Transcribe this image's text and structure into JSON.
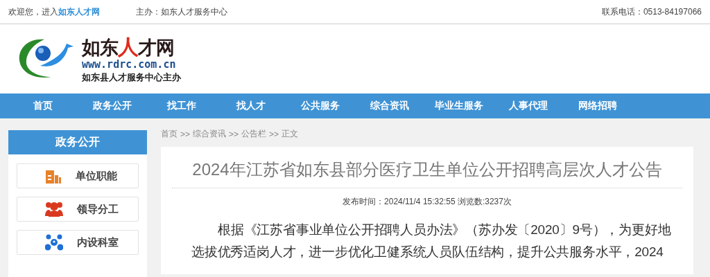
{
  "top_bar": {
    "welcome": "欢迎您，进入",
    "site_link": "如东人才网",
    "host": "主办：如东人才服务中心",
    "phone": "联系电话：0513-84197066"
  },
  "logo": {
    "title_parts": [
      {
        "text": "如东",
        "highlight": false
      },
      {
        "text": "人",
        "highlight": true
      },
      {
        "text": "才网",
        "highlight": false
      }
    ],
    "url": "www.rdrc.com.cn",
    "subtitle": "如东县人才服务中心主办"
  },
  "nav": [
    {
      "label": "首页"
    },
    {
      "label": "政务公开"
    },
    {
      "label": "找工作"
    },
    {
      "label": "找人才"
    },
    {
      "label": "公共服务"
    },
    {
      "label": "综合资讯"
    },
    {
      "label": "毕业生服务"
    },
    {
      "label": "人事代理"
    },
    {
      "label": "网络招聘"
    }
  ],
  "sidebar": {
    "title": "政务公开",
    "items": [
      {
        "label": "单位职能",
        "kind": "building",
        "color": "#e8822a"
      },
      {
        "label": "领导分工",
        "kind": "people",
        "color": "#d93a1f"
      },
      {
        "label": "内设科室",
        "kind": "network",
        "color": "#1f6fd6"
      }
    ]
  },
  "breadcrumb": [
    {
      "label": "首页"
    },
    {
      "label": "综合资讯"
    },
    {
      "label": "公告栏"
    },
    {
      "label": "正文"
    }
  ],
  "breadcrumb_separator": ">>",
  "article": {
    "title": "2024年江苏省如东县部分医疗卫生单位公开招聘高层次人才公告",
    "meta": "发布时间：2024/11/4 15:32:55 浏览数:3237次",
    "body": "根据《江苏省事业单位公开招聘人员办法》（苏办发〔2020〕9号），为更好地选拔优秀适岗人才，进一步优化卫健系统人员队伍结构，提升公共服务水平，2024"
  }
}
